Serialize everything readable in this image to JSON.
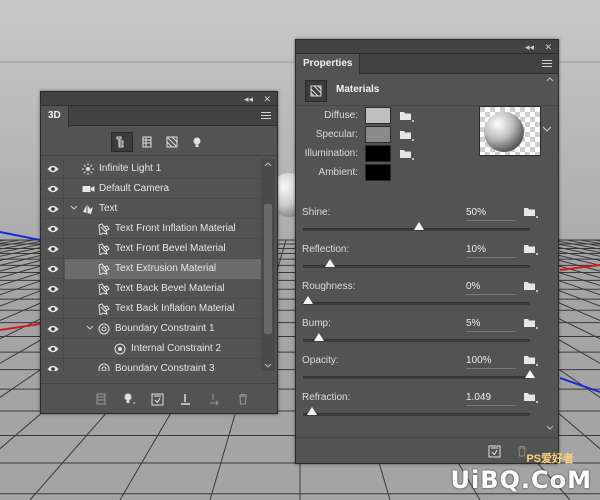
{
  "panel3d": {
    "tab": "3D",
    "collapse_glyph": "◂◂",
    "close_glyph": "✕",
    "filters": [
      {
        "name": "scene-filter-icon",
        "active": true
      },
      {
        "name": "mesh-filter-icon",
        "active": false
      },
      {
        "name": "material-filter-icon",
        "active": false
      },
      {
        "name": "light-filter-icon",
        "active": false
      }
    ],
    "layers": [
      {
        "label": "Infinite Light 1",
        "icon": "infinite-light-icon",
        "indent": 0,
        "expand": "none"
      },
      {
        "label": "Default Camera",
        "icon": "camera-icon",
        "indent": 0,
        "expand": "none"
      },
      {
        "label": "Text",
        "icon": "mesh-icon",
        "indent": 0,
        "expand": "open"
      },
      {
        "label": "Text Front Inflation Material",
        "icon": "material-icon",
        "indent": 1,
        "expand": "none"
      },
      {
        "label": "Text Front Bevel Material",
        "icon": "material-icon",
        "indent": 1,
        "expand": "none"
      },
      {
        "label": "Text Extrusion Material",
        "icon": "material-icon",
        "indent": 1,
        "expand": "none",
        "selected": true
      },
      {
        "label": "Text Back Bevel Material",
        "icon": "material-icon",
        "indent": 1,
        "expand": "none"
      },
      {
        "label": "Text Back Inflation Material",
        "icon": "material-icon",
        "indent": 1,
        "expand": "none"
      },
      {
        "label": "Boundary Constraint 1",
        "icon": "constraint-icon",
        "indent": 1,
        "expand": "open"
      },
      {
        "label": "Internal Constraint 2",
        "icon": "internal-constraint-icon",
        "indent": 2,
        "expand": "none"
      },
      {
        "label": "Boundary Constraint 3",
        "icon": "constraint-icon",
        "indent": 1,
        "expand": "none"
      }
    ],
    "bottom_buttons": [
      "scene-settings-icon",
      "new-light-icon",
      "render-icon",
      "ground-plane-icon",
      "drop-to-ground-icon",
      "delete-icon"
    ]
  },
  "properties": {
    "tab": "Properties",
    "collapse_glyph": "◂◂",
    "close_glyph": "✕",
    "section_title": "Materials",
    "colors": [
      {
        "label": "Diffuse:",
        "color": "#bfbfbf"
      },
      {
        "label": "Specular:",
        "color": "#8a8a8a"
      },
      {
        "label": "Illumination:",
        "color": "#000000"
      },
      {
        "label": "Ambient:",
        "color": "#000000"
      }
    ],
    "sliders": [
      {
        "label": "Shine:",
        "value": "50%",
        "level": 0.5
      },
      {
        "label": "Reflection:",
        "value": "10%",
        "level": 0.1
      },
      {
        "label": "Roughness:",
        "value": "0%",
        "level": 0.0
      },
      {
        "label": "Bump:",
        "value": "5%",
        "level": 0.05
      },
      {
        "label": "Opacity:",
        "value": "100%",
        "level": 1.0
      },
      {
        "label": "Refraction:",
        "value": "1.049",
        "level": 0.02
      }
    ]
  },
  "watermark": {
    "top": "PS爱好者",
    "main": "UiBQ.CoM"
  },
  "colors": {
    "panel": "#535353",
    "panel_dark": "#424242",
    "selected_row": "#6b6b6b",
    "axis_red": "#d81b1b",
    "axis_blue": "#1b2bd8"
  }
}
